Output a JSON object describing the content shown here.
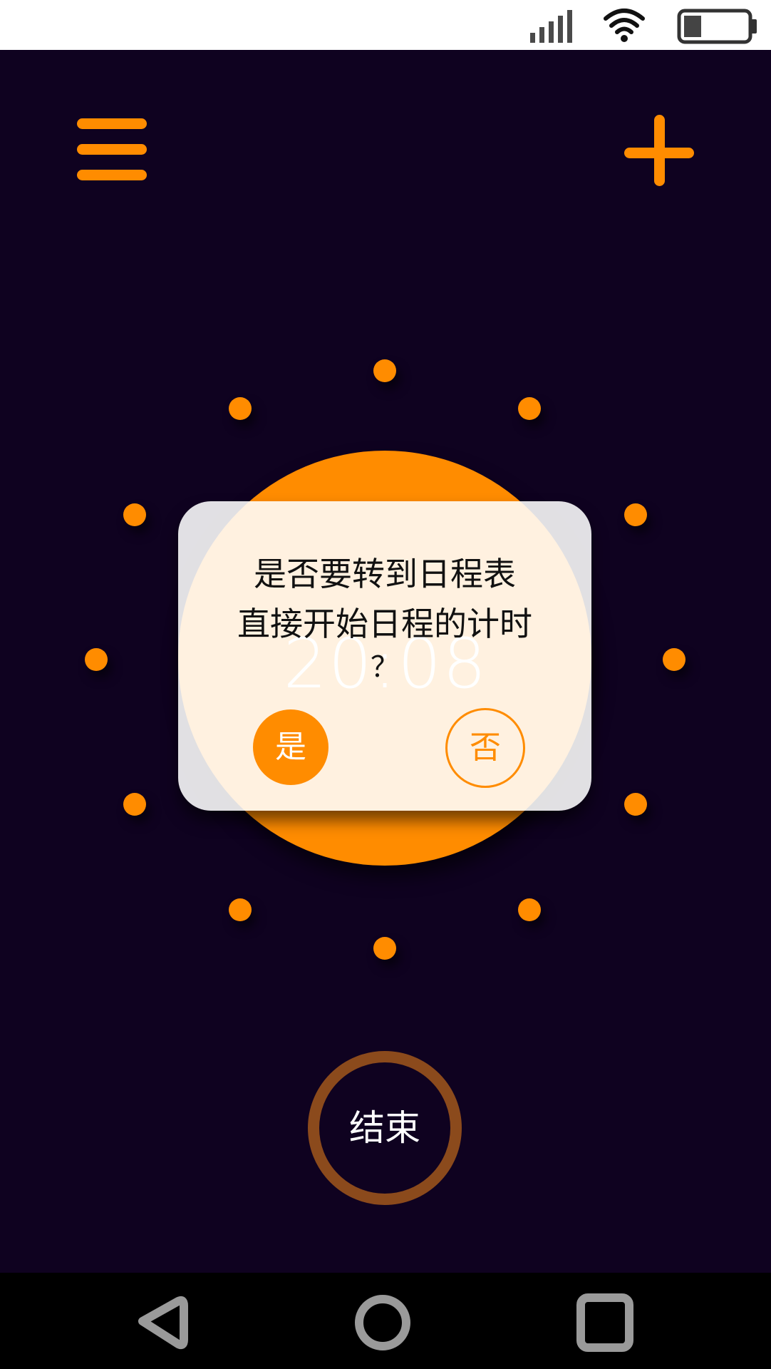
{
  "status_bar": {
    "icons": [
      "signal-icon",
      "wifi-icon",
      "battery-icon"
    ],
    "battery_level": 0.25
  },
  "header": {
    "menu_icon": "menu-icon",
    "add_icon": "plus-icon"
  },
  "timer": {
    "time": "20:08"
  },
  "dialog": {
    "line1": "是否要转到日程表",
    "line2": "直接开始日程的计时",
    "line3": "？",
    "yes_label": "是",
    "no_label": "否"
  },
  "end_button": {
    "label": "结束"
  },
  "nav_bar": {
    "back_icon": "back-icon",
    "home_icon": "home-icon",
    "recents_icon": "recents-icon"
  },
  "colors": {
    "accent": "#ff8c00",
    "background": "#0f0220",
    "end_ring": "#8b4a1c",
    "dialog_bg": "#ffffff"
  }
}
